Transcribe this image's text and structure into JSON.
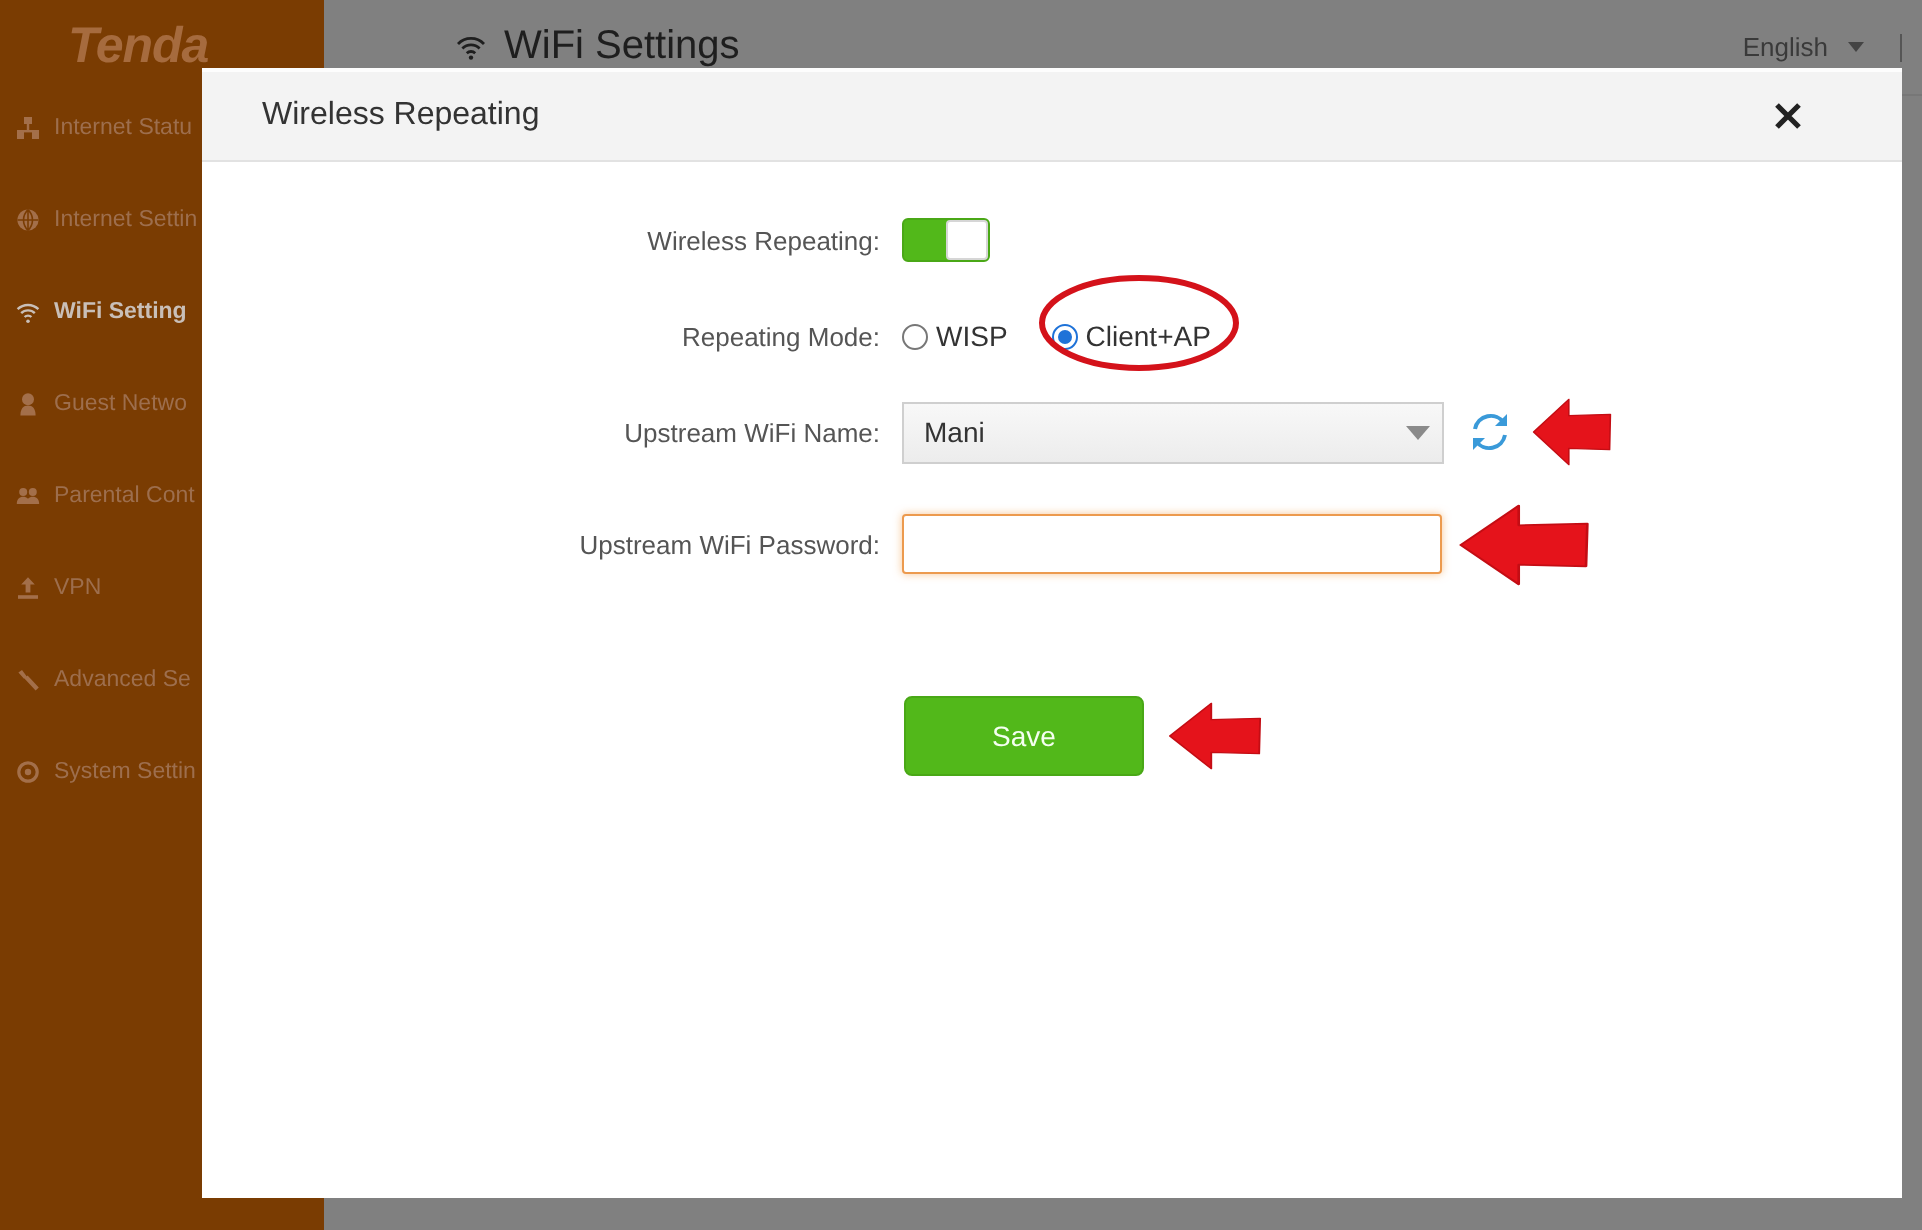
{
  "sidebar": {
    "logo": "Tenda",
    "items": [
      {
        "label": "Internet Statu",
        "selected": false
      },
      {
        "label": "Internet Settin",
        "selected": false
      },
      {
        "label": "WiFi Setting",
        "selected": true
      },
      {
        "label": "Guest Netwo",
        "selected": false
      },
      {
        "label": "Parental Cont",
        "selected": false
      },
      {
        "label": "VPN",
        "selected": false
      },
      {
        "label": "Advanced Se",
        "selected": false
      },
      {
        "label": "System Settin",
        "selected": false
      }
    ]
  },
  "header": {
    "title": "WiFi Settings",
    "language": "English"
  },
  "dialog": {
    "title": "Wireless Repeating",
    "fields": [
      {
        "kind": "toggle",
        "label": "Wireless Repeating:",
        "on": true
      },
      {
        "kind": "radio",
        "label": "Repeating Mode:",
        "options": [
          {
            "label": "WISP",
            "selected": false
          },
          {
            "label": "Client+AP",
            "selected": true,
            "annotated": true
          }
        ]
      },
      {
        "kind": "select",
        "label": "Upstream WiFi Name:",
        "value": "Mani",
        "annotated": true
      },
      {
        "kind": "password",
        "label": "Upstream WiFi Password:",
        "focused": true,
        "annotated": true
      }
    ],
    "save": {
      "label": "Save",
      "annotated": true
    }
  }
}
